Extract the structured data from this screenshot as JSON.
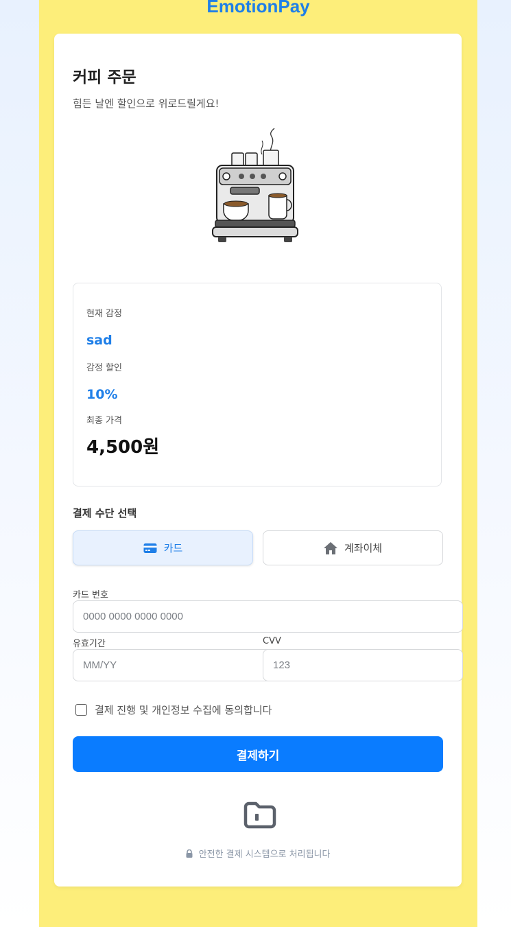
{
  "app": {
    "brand": "EmotionPay"
  },
  "order": {
    "title": "커피 주문",
    "subtitle": "힘든 날엔 할인으로 위로드릴게요!"
  },
  "info": {
    "emotion_label": "현재 감정",
    "emotion_value": "sad",
    "discount_label": "감정 할인",
    "discount_value": "10%",
    "final_label": "최종 가격",
    "final_value": "4,500원"
  },
  "payment": {
    "section_title": "결제 수단 선택",
    "methods": [
      {
        "label": "카드",
        "icon": "credit-card-icon",
        "selected": true
      },
      {
        "label": "계좌이체",
        "icon": "home-icon",
        "selected": false
      }
    ],
    "card_number_label": "카드 번호",
    "card_number_placeholder": "0000 0000 0000 0000",
    "expiry_label": "유효기간",
    "expiry_placeholder": "MM/YY",
    "cvv_label": "CVV",
    "cvv_placeholder": "123",
    "agree_text": "결제 진행 및 개인정보 수집에 동의합니다",
    "submit_label": "결제하기"
  },
  "footer": {
    "icon": "folder-icon",
    "secure_text": "안전한 결제 시스템으로 처리됩니다"
  },
  "colors": {
    "accent": "#1f7fe8",
    "button": "#0a7cff",
    "frame": "#fdee7a"
  }
}
